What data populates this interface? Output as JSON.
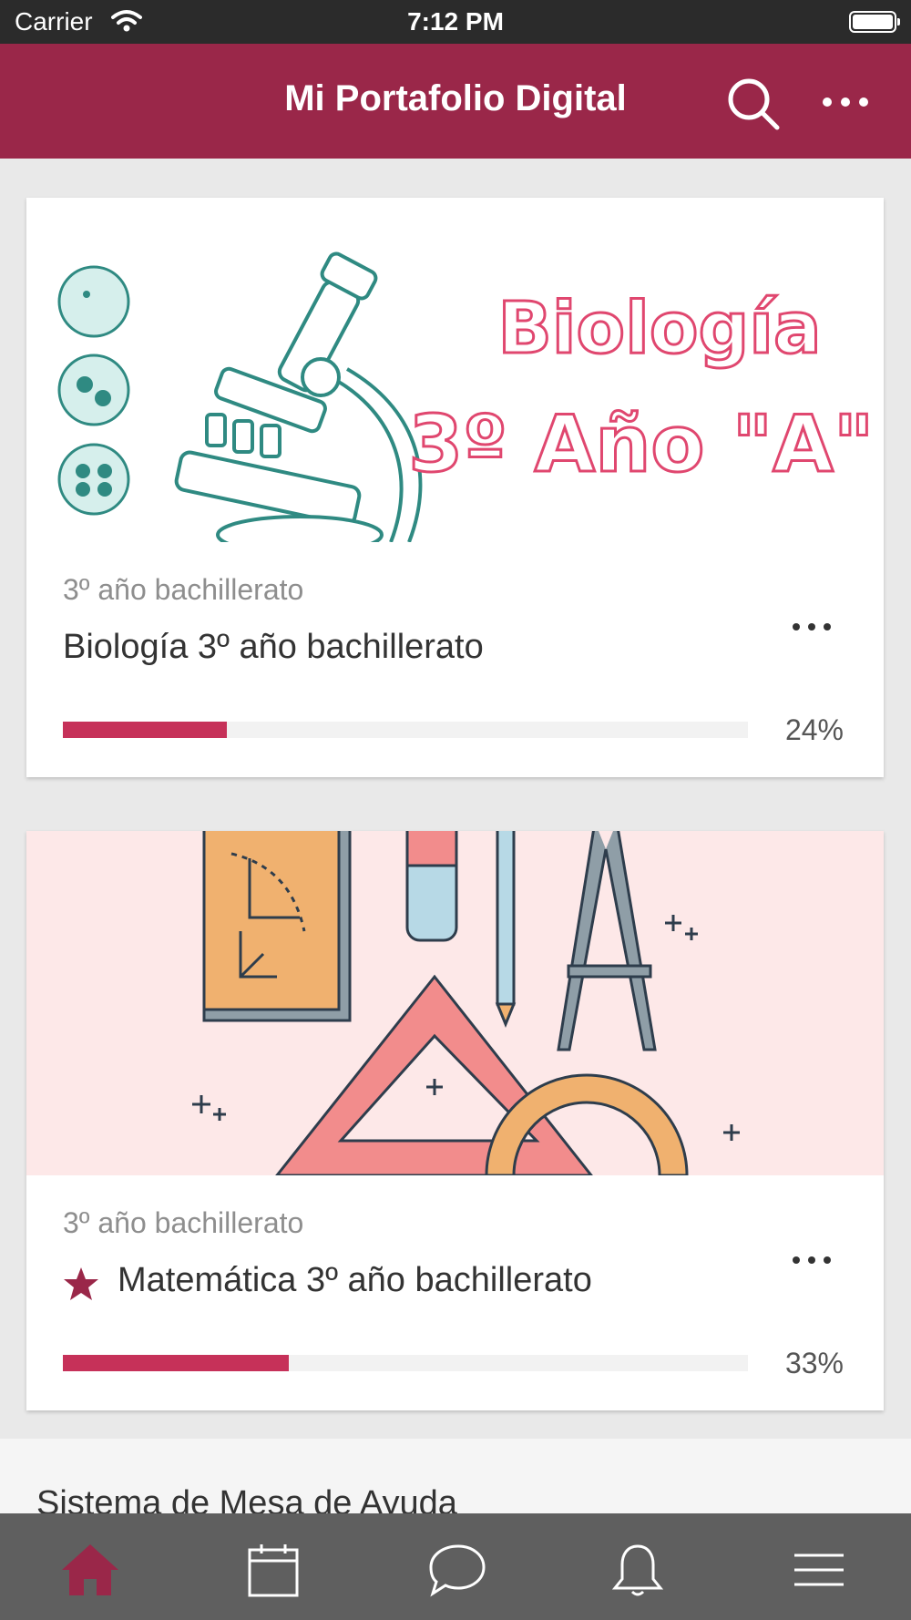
{
  "status_bar": {
    "carrier": "Carrier",
    "time": "7:12 PM"
  },
  "app_bar": {
    "title": "Mi Portafolio Digital"
  },
  "courses": [
    {
      "image_text_line1": "Biología",
      "image_text_line2": "3º Año \"A\"",
      "subtitle": "3º año bachillerato",
      "name": "Biología 3º año bachillerato",
      "progress": 0.24,
      "progress_label": "24%",
      "starred": false
    },
    {
      "subtitle": "3º año bachillerato",
      "name": "Matemática 3º año bachillerato",
      "progress": 0.33,
      "progress_label": "33%",
      "starred": true
    }
  ],
  "help_section": {
    "title": "Sistema de Mesa de Ayuda"
  },
  "tab_bar": {
    "items": [
      "home-icon",
      "calendar-icon",
      "chat-icon",
      "bell-icon",
      "menu-icon"
    ],
    "active": "home-icon"
  },
  "colors": {
    "brand": "#9a2749",
    "progress": "#c63159",
    "tab_active": "#9a2749",
    "tab_inactive": "#ffffff"
  }
}
